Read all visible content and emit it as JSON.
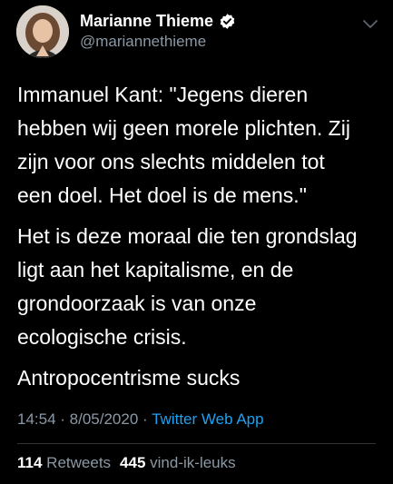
{
  "user": {
    "display_name": "Marianne Thieme",
    "handle": "@mariannethieme",
    "verified": true
  },
  "tweet": {
    "paragraphs": [
      "Immanuel Kant: \"Jegens dieren\nhebben wij geen morele plichten. Zij\nzijn voor ons slechts middelen tot\neen doel. Het doel is de mens.\"",
      "Het is deze moraal die ten grondslag\nligt aan het kapitalisme, en de\ngrondoorzaak is van onze\necologische crisis.",
      "Antropocentrisme sucks"
    ]
  },
  "meta": {
    "time": "14:54",
    "separator": " · ",
    "date": "8/05/2020",
    "separator2": " · ",
    "source_app": "Twitter Web App"
  },
  "stats": {
    "retweets_count": "114",
    "retweets_label": "Retweets",
    "likes_count": "445",
    "likes_label": "vind-ik-leuks"
  },
  "icons": {
    "verified": "verified-badge-icon",
    "menu": "chevron-down-icon"
  },
  "colors": {
    "background": "#000000",
    "text": "#ffffff",
    "secondary": "#8b98a5",
    "link": "#1da1f2",
    "divider": "#2f3336"
  }
}
